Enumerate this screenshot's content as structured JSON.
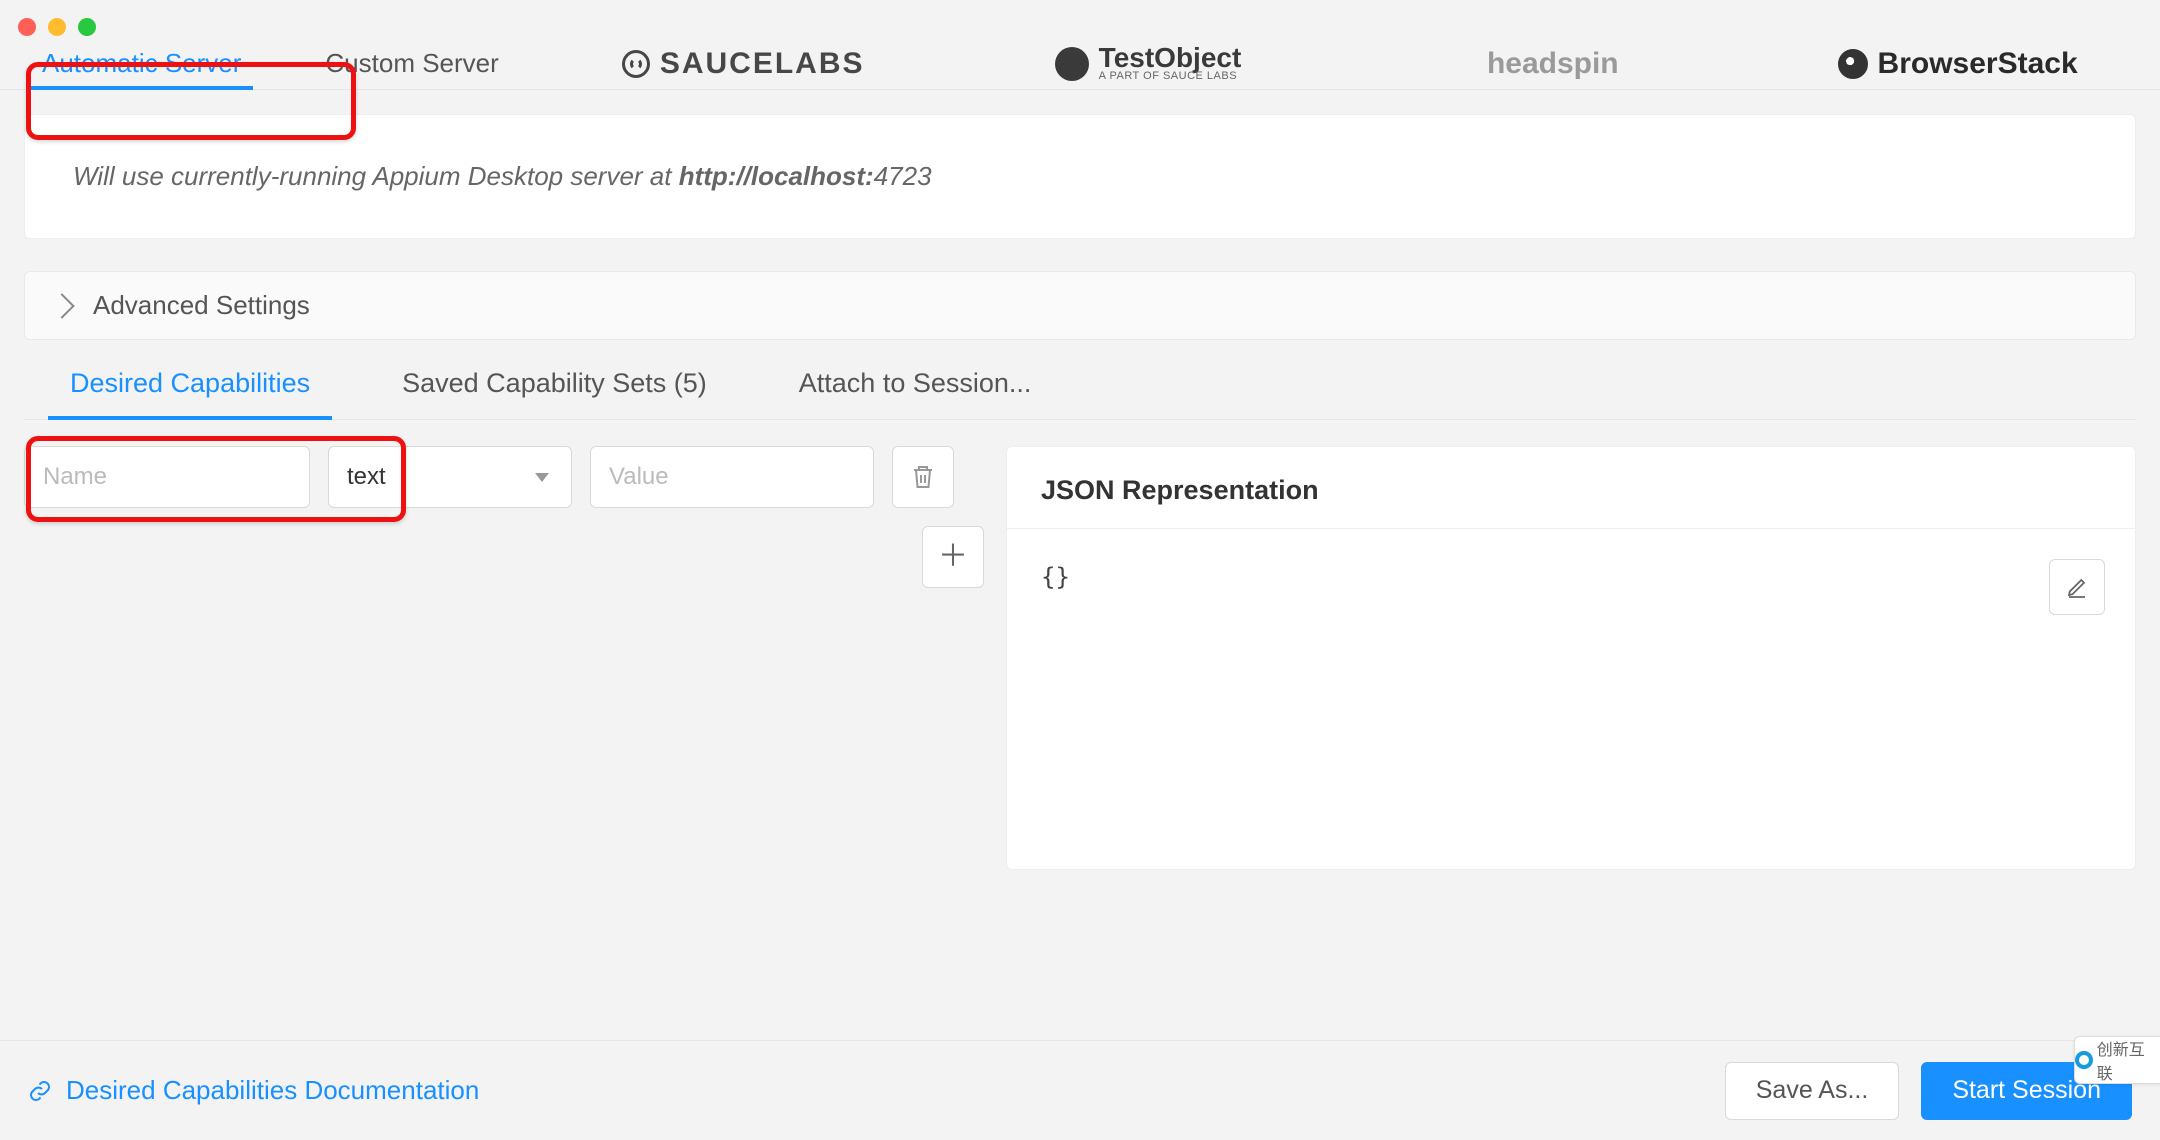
{
  "server_tabs": {
    "automatic": "Automatic Server",
    "custom": "Custom Server",
    "sauce": "SAUCELABS",
    "testobject_name": "TestObject",
    "testobject_sub": "A PART OF SAUCE LABS",
    "headspin": "headspin",
    "browserstack": "BrowserStack"
  },
  "info": {
    "prefix": "Will use currently-running Appium Desktop server at ",
    "host": "http://localhost:",
    "port": "4723"
  },
  "advanced_label": "Advanced Settings",
  "cap_tabs": {
    "desired": "Desired Capabilities",
    "saved": "Saved Capability Sets (5)",
    "attach": "Attach to Session..."
  },
  "cap_row": {
    "name_placeholder": "Name",
    "type_value": "text",
    "value_placeholder": "Value"
  },
  "json_panel": {
    "title": "JSON Representation",
    "body": "{}"
  },
  "footer": {
    "doc_link": "Desired Capabilities Documentation",
    "save_as": "Save As...",
    "start": "Start Session"
  },
  "watermark": "创新互联"
}
